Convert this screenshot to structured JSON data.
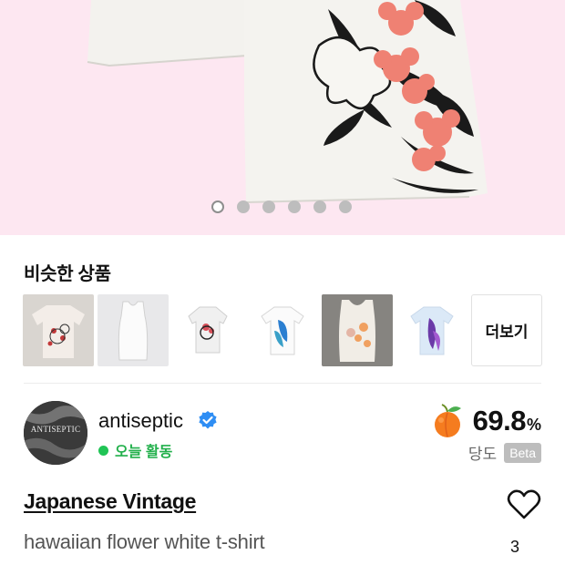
{
  "gallery": {
    "image": "hawaiian-flower-white-tshirt-photo",
    "page_count": 6,
    "active_index": 0
  },
  "similar": {
    "title": "비슷한 상품",
    "more_label": "더보기",
    "thumbnails": [
      "similar-item-1",
      "similar-item-2",
      "similar-item-3",
      "similar-item-4",
      "similar-item-5",
      "similar-item-6"
    ]
  },
  "seller": {
    "name": "antiseptic",
    "avatar_text": "ANTISEPTIC",
    "activity": "오늘 활동",
    "verified_icon": "verified-badge-icon",
    "score": "69.8",
    "score_unit": "%",
    "score_icon": "peach-icon",
    "sweetness_label": "당도",
    "beta_label": "Beta"
  },
  "product": {
    "brand": "Japanese Vintage",
    "title": "hawaiian flower white t-shirt",
    "like_count": "3",
    "like_icon": "heart-outline-icon"
  },
  "colors": {
    "hero_bg": "#fde7f1",
    "activity_green": "#22b04b",
    "beta_bg": "#bdbdbd"
  }
}
